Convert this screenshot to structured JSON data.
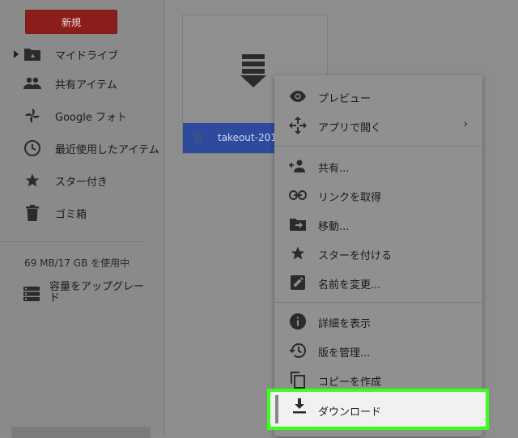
{
  "sidebar": {
    "new_button": "新規",
    "items": [
      {
        "label": "マイドライブ",
        "icon": "drive-folder-icon"
      },
      {
        "label": "共有アイテム",
        "icon": "people-icon"
      },
      {
        "label": "Google フォト",
        "icon": "pinwheel-icon"
      },
      {
        "label": "最近使用したアイテム",
        "icon": "clock-icon"
      },
      {
        "label": "スター付き",
        "icon": "star-icon"
      },
      {
        "label": "ゴミ箱",
        "icon": "trash-icon"
      }
    ],
    "storage_text": "69 MB/17 GB を使用中",
    "upgrade_label": "容量をアップグレード"
  },
  "file": {
    "name": "takeout-201"
  },
  "context_menu": {
    "items": [
      {
        "label": "プレビュー",
        "icon": "eye-icon"
      },
      {
        "label": "アプリで開く",
        "icon": "move-arrows-icon",
        "submenu": "›"
      },
      {
        "label": "共有...",
        "icon": "person-add-icon"
      },
      {
        "label": "リンクを取得",
        "icon": "link-icon"
      },
      {
        "label": "移動...",
        "icon": "folder-move-icon"
      },
      {
        "label": "スターを付ける",
        "icon": "star-icon"
      },
      {
        "label": "名前を変更...",
        "icon": "pencil-icon"
      },
      {
        "label": "詳細を表示",
        "icon": "info-icon"
      },
      {
        "label": "版を管理...",
        "icon": "history-icon"
      },
      {
        "label": "コピーを作成",
        "icon": "copy-icon"
      },
      {
        "label": "ダウンロード",
        "icon": "download-icon"
      }
    ]
  },
  "colors": {
    "highlight_border": "#39ff1c",
    "new_button": "#8b1e1a",
    "file_footer": "#2e4a9e"
  }
}
